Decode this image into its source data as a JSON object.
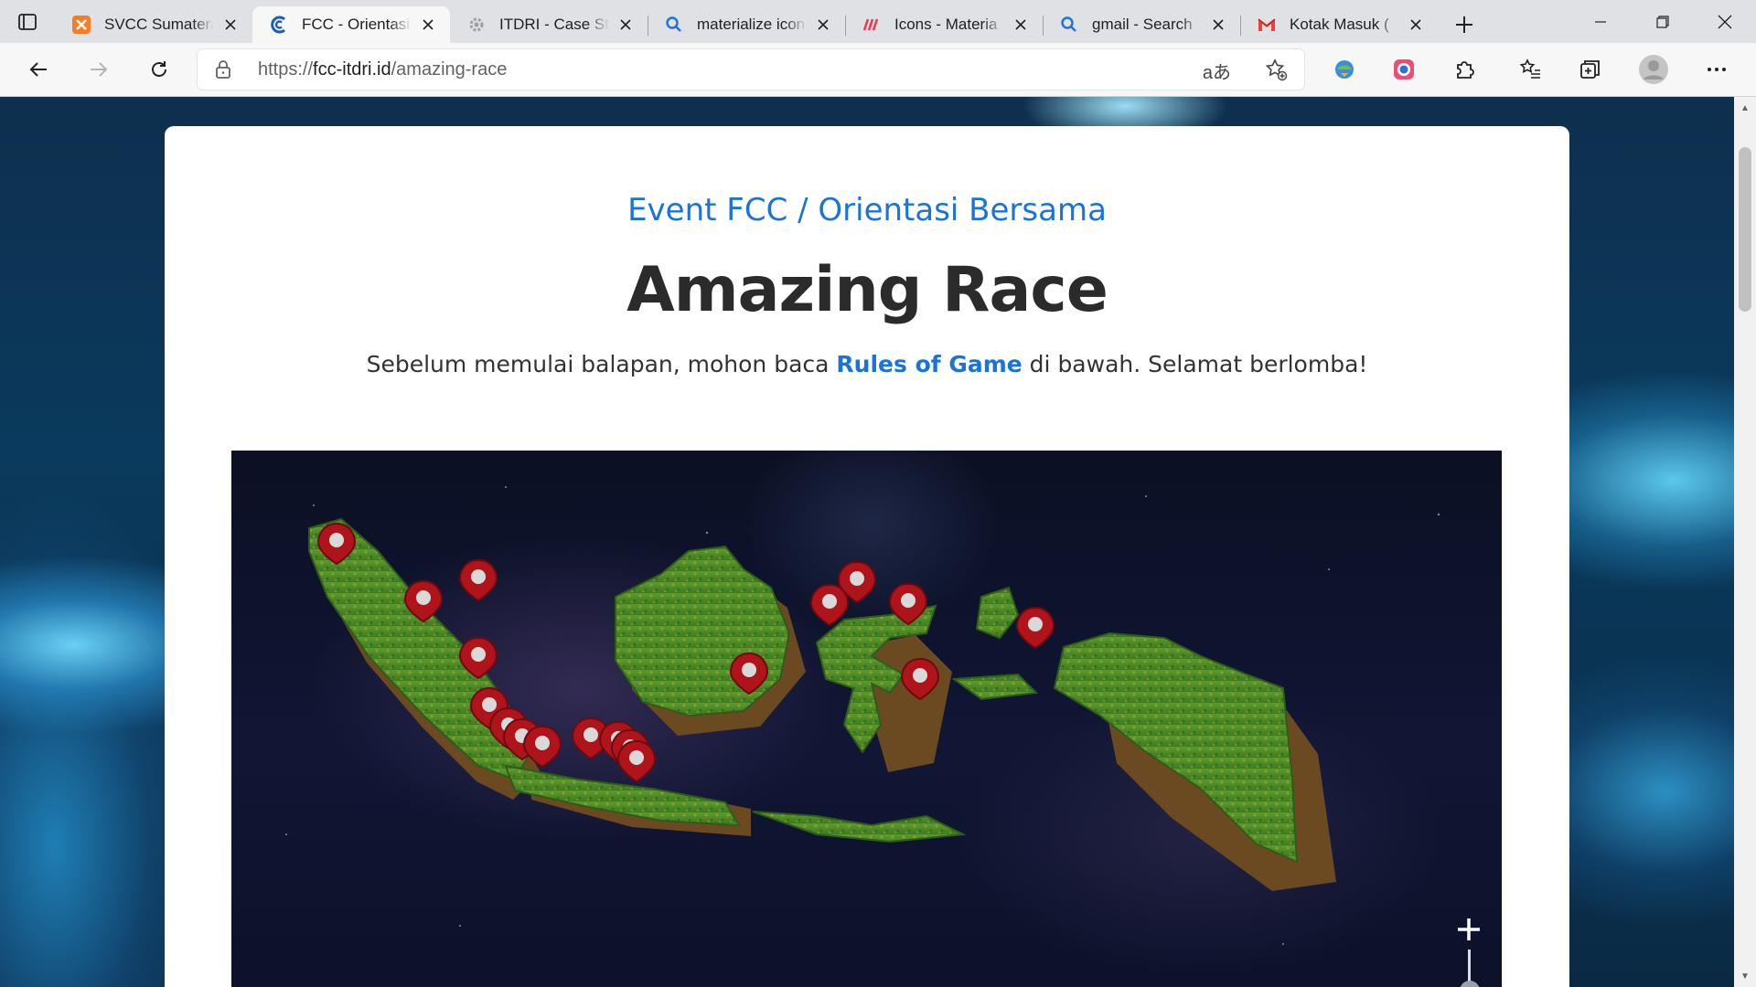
{
  "browser": {
    "tabs": [
      {
        "title": "SVCC Sumatera",
        "icon": "xampp-icon",
        "active": false
      },
      {
        "title": "FCC - Orientasi",
        "icon": "fcc-icon",
        "active": true
      },
      {
        "title": "ITDRI - Case St",
        "icon": "gear-icon",
        "active": false
      },
      {
        "title": "materialize icon",
        "icon": "search-icon",
        "active": false
      },
      {
        "title": "Icons - Materia",
        "icon": "materialize-icon",
        "active": false
      },
      {
        "title": "gmail - Search",
        "icon": "search-icon",
        "active": false
      },
      {
        "title": "Kotak Masuk (",
        "icon": "gmail-icon",
        "active": false
      }
    ],
    "address": {
      "scheme": "https://",
      "host": "fcc-itdri.id",
      "path": "/amazing-race"
    },
    "read_aloud_glyph": "aあ"
  },
  "page": {
    "eyebrow": "Event FCC / Orientasi Bersama",
    "headline": "Amazing Race",
    "subtitle_before": "Sebelum memulai balapan, mohon baca ",
    "subtitle_link": "Rules of Game",
    "subtitle_after": " di bawah. Selamat berlomba!",
    "map": {
      "zoom_plus": "+"
    }
  },
  "colors": {
    "accent": "#1a73d9",
    "marker": "#b0141b",
    "land": "#4e8a2a"
  }
}
